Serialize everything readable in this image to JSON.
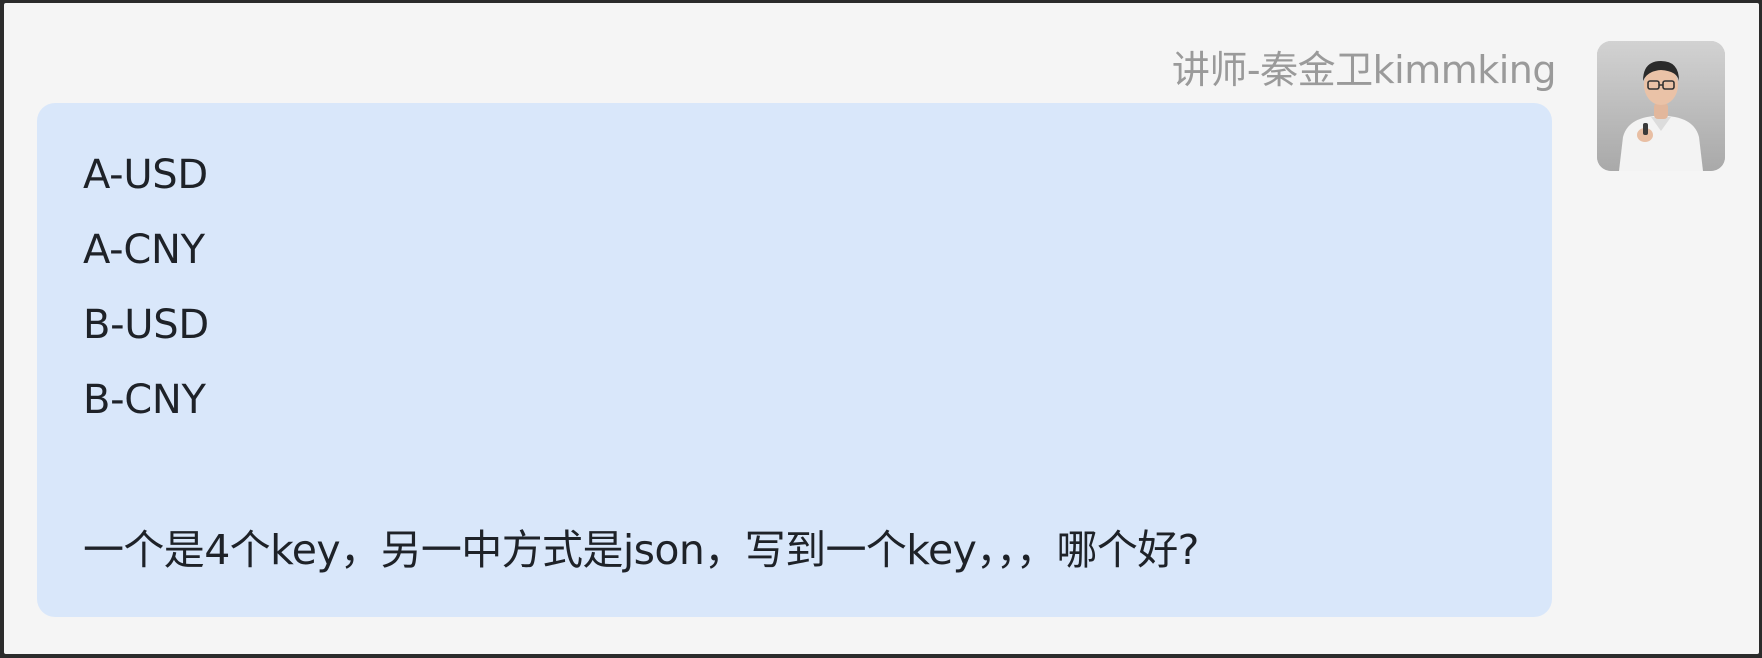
{
  "message": {
    "sender": "讲师-秦金卫kimmking",
    "avatar_icon": "person-portrait-icon",
    "lines": [
      "A-USD",
      "A-CNY",
      "B-USD",
      "B-CNY"
    ],
    "question": "一个是4个key，另一中方式是json，写到一个key，，，哪个好?"
  },
  "colors": {
    "panel_background": "#f5f5f5",
    "bubble_background": "#d9e7fa",
    "sender_text": "#9a9a9a",
    "message_text": "#1e2228"
  }
}
